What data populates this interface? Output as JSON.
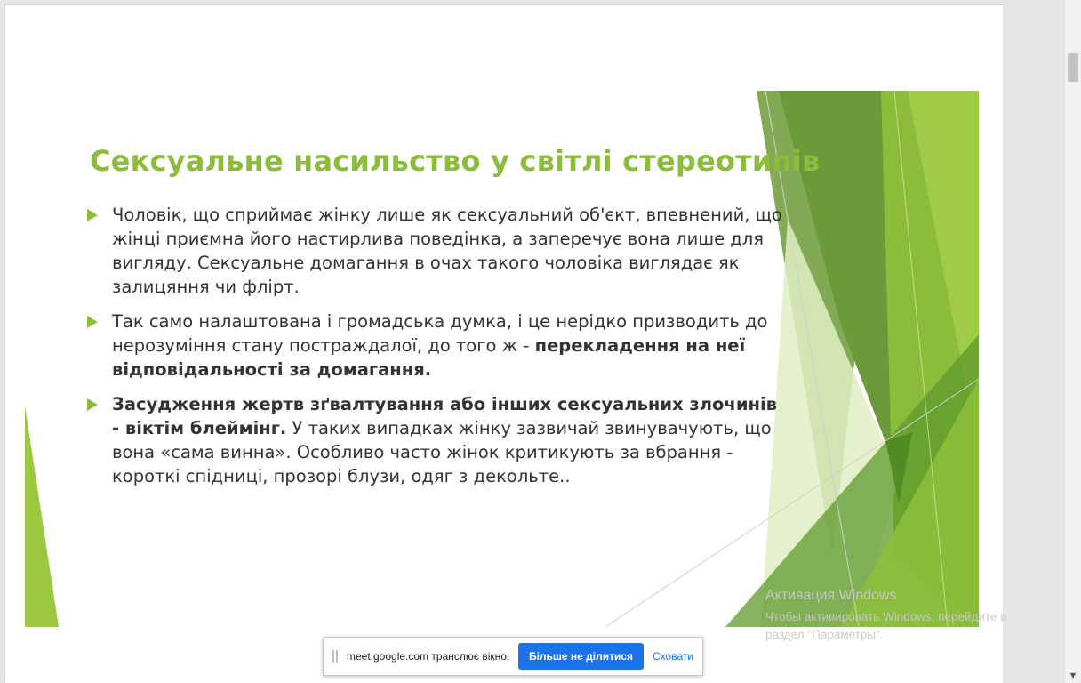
{
  "slide": {
    "title": "Сексуальне насильство у світлі стереотипів",
    "bullets": [
      {
        "text_plain": " Чоловік, що сприймає жінку лише як сексуальний об'єкт, впевнений, що жінці приємна його настирлива поведінка, а  заперечує вона лише для вигляду. Сексуальне домагання в очах такого чоловіка виглядає як залицяння чи флірт."
      },
      {
        "text_plain": "Так само налаштована  і громадська думка, і це нерідко призводить до нерозуміння стану постраждалої, до того ж - ",
        "text_bold": "перекладення на неї відповідальності за домагання."
      },
      {
        "text_bold": "Засудження жертв зґвалтування або інших сексуальних злочинів - віктім блеймінг.",
        "text_plain": " У таких випадках жінку зазвичай звинувачують, що вона «сама винна». Особливо часто жінок критикують за вбрання - короткі спідниці, прозорі блузи, одяг з декольте.."
      }
    ],
    "accent_color": "#8cbd3a"
  },
  "share_bar": {
    "message": "meet.google.com транслює вікно.",
    "stop_label": "Більше не ділитися",
    "hide_label": "Сховати",
    "button_color": "#1a73e8"
  },
  "watermark": {
    "title": "Активация Windows",
    "line1": "Чтобы активировать Windows, перейдите в",
    "line2": "раздел \"Параметры\"."
  },
  "icons": {
    "bullet": "triangle-right-icon",
    "grip": "drag-handle-icon",
    "scroll_down": "chevron-down-icon"
  }
}
